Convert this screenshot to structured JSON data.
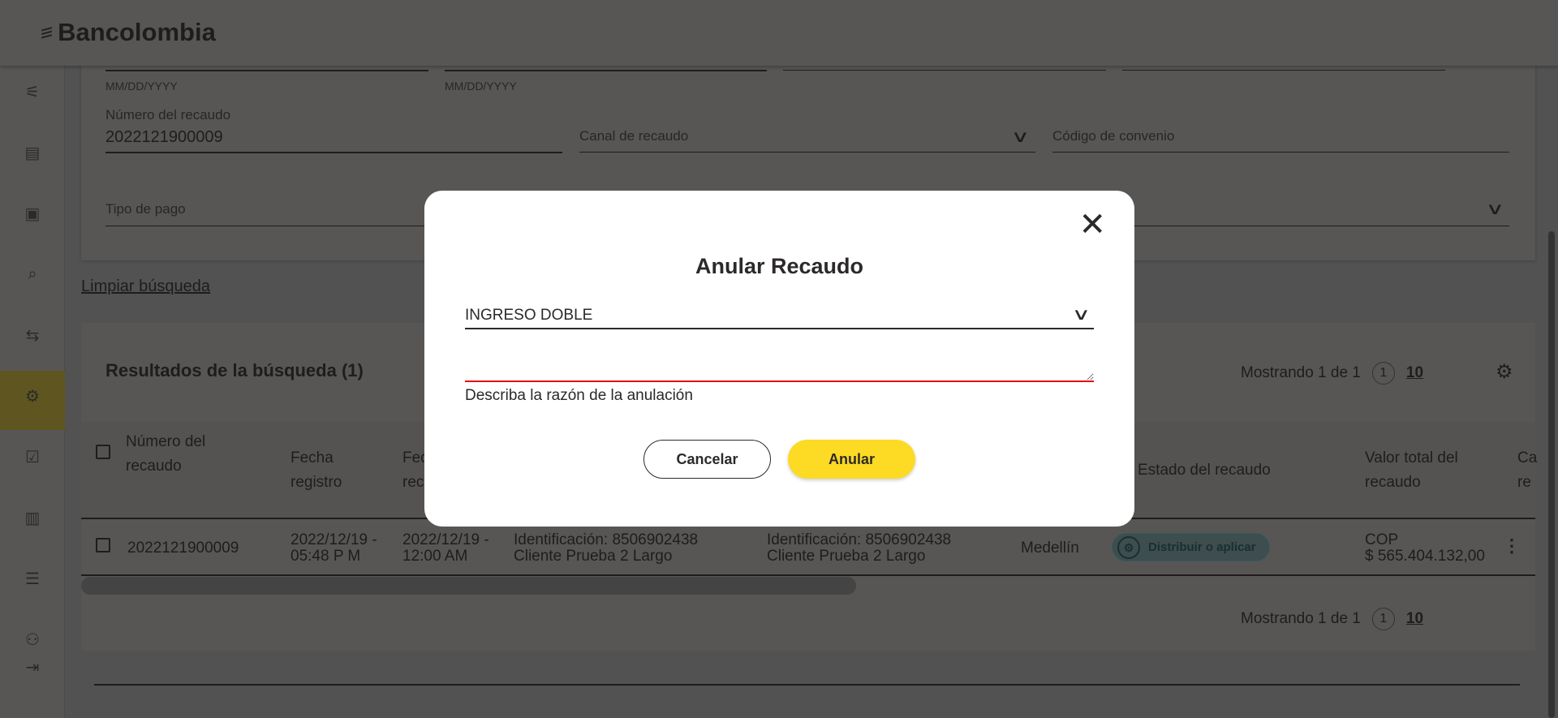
{
  "header": {
    "brand": "Bancolombia"
  },
  "sidebar": {
    "items": [
      {
        "icon": "sliders-icon"
      },
      {
        "icon": "receipt-icon"
      },
      {
        "icon": "money-icon"
      },
      {
        "icon": "document-search-icon"
      },
      {
        "icon": "transfer-icon",
        "active": true
      },
      {
        "icon": "gear-icon"
      },
      {
        "icon": "document-check-icon"
      },
      {
        "icon": "book-icon"
      },
      {
        "icon": "list-icon"
      },
      {
        "icon": "users-icon"
      },
      {
        "icon": "logout-icon"
      }
    ]
  },
  "filters": {
    "date_hint_1": "MM/DD/YYYY",
    "date_hint_2": "MM/DD/YYYY",
    "numero_label": "Número del recaudo",
    "numero_value": "2022121900009",
    "canal_label": "Canal de recaudo",
    "codigo_label": "Código de convenio",
    "tipo_label": "Tipo de pago",
    "clear_link": "Limpiar búsqueda"
  },
  "results": {
    "title": "Resultados de la búsqueda (1)",
    "showing": "Mostrando 1 de 1",
    "page": "1",
    "page_size": "10",
    "columns": [
      "Número del recaudo",
      "Fecha registro",
      "Fecha recaudo",
      "",
      "",
      "",
      "Estado del recaudo",
      "Valor total del recaudo",
      "Ca re"
    ],
    "rows": [
      {
        "numero": "2022121900009",
        "fecha_registro": "2022/12/19 - 05:48 P M",
        "fecha_recaudo": "2022/12/19 - 12:00 AM",
        "pagador_id": "Identificación: 8506902438",
        "pagador_nombre": "Cliente Prueba 2 Largo",
        "titular_id": "Identificación: 8506902438",
        "titular_nombre": "Cliente Prueba 2 Largo",
        "ciudad": "Medellín",
        "estado": "Distribuir o aplicar",
        "moneda": "COP",
        "valor": "$ 565.404.132,00"
      }
    ]
  },
  "modal": {
    "title": "Anular Recaudo",
    "reason_value": "INGRESO DOBLE",
    "helper": "Describa la razón de la anulación",
    "cancel": "Cancelar",
    "confirm": "Anular"
  },
  "colors": {
    "accent": "#fdda24",
    "error": "#e20a16",
    "badge": "#b9e4e8"
  }
}
